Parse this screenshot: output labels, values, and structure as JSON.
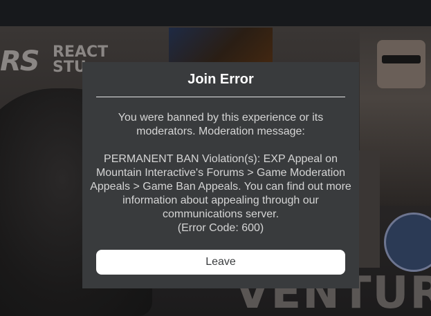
{
  "background": {
    "logo_mark": "RS",
    "logo_text_line1": "REACT",
    "logo_text_line2": "STU",
    "big_word": "VENTURA",
    "colors": {
      "topbar": "#17191c",
      "backdrop": "#2c2928"
    }
  },
  "dialog": {
    "title": "Join Error",
    "message_line1": "You were banned by this experience or its",
    "message_line2": "moderators. Moderation message:",
    "message_line3": "PERMANENT BAN Violation(s): EXP Appeal on",
    "message_line4": "Mountain Interactive's Forums > Game Moderation",
    "message_line5": "Appeals > Game Ban Appeals. You can find out more",
    "message_line6": "information about appealing through our",
    "message_line7": "communications server.",
    "error_code": "(Error Code: 600)",
    "leave_label": "Leave",
    "colors": {
      "panel": "#393b3d",
      "title": "#ffffff",
      "text": "#d5d5d5",
      "button_bg": "#ffffff",
      "button_text": "#393b3d"
    }
  }
}
